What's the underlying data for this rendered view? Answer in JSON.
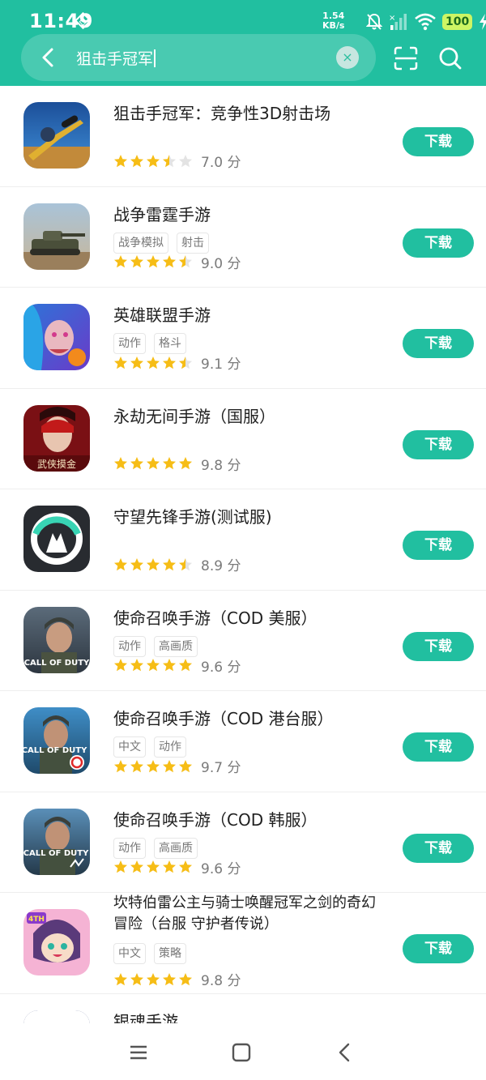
{
  "status": {
    "time": "11:49",
    "speed_value": "1.54",
    "speed_unit": "KB/s",
    "battery": "100"
  },
  "search": {
    "query": "狙击手冠军",
    "clear_symbol": "×"
  },
  "colors": {
    "accent": "#21bfa0",
    "star": "#f6bd16",
    "star_empty": "#e3e3e3"
  },
  "apps": [
    {
      "name": "狙击手冠军：竞争性3D射击场",
      "tags": [],
      "rating": 3.5,
      "score": "7.0 分",
      "button": "下载"
    },
    {
      "name": "战争雷霆手游",
      "tags": [
        "战争模拟",
        "射击"
      ],
      "rating": 4.5,
      "score": "9.0 分",
      "button": "下载"
    },
    {
      "name": "英雄联盟手游",
      "tags": [
        "动作",
        "格斗"
      ],
      "rating": 4.5,
      "score": "9.1 分",
      "button": "下载"
    },
    {
      "name": "永劫无间手游（国服）",
      "tags": [],
      "rating": 5,
      "score": "9.8 分",
      "button": "下载"
    },
    {
      "name": "守望先锋手游(测试服)",
      "tags": [],
      "rating": 4.5,
      "score": "8.9 分",
      "button": "下载"
    },
    {
      "name": "使命召唤手游（COD 美服）",
      "tags": [
        "动作",
        "高画质"
      ],
      "rating": 5,
      "score": "9.6 分",
      "button": "下载"
    },
    {
      "name": "使命召唤手游（COD 港台服）",
      "tags": [
        "中文",
        "动作"
      ],
      "rating": 5,
      "score": "9.7 分",
      "button": "下载"
    },
    {
      "name": "使命召唤手游（COD 韩服）",
      "tags": [
        "动作",
        "高画质"
      ],
      "rating": 5,
      "score": "9.6 分",
      "button": "下载"
    },
    {
      "name": "坎特伯雷公主与骑士唤醒冠军之剑的奇幻冒险（台服 守护者传说）",
      "tags": [
        "中文",
        "策略"
      ],
      "rating": 5,
      "score": "9.8 分",
      "button": "下载"
    },
    {
      "name": "银魂手游",
      "tags": [],
      "rating": null,
      "score": "",
      "button": ""
    }
  ],
  "icon_texts": {
    "naraka": "武侠摸金",
    "cod": "CALL OF DUTY",
    "gk": "4TH"
  }
}
